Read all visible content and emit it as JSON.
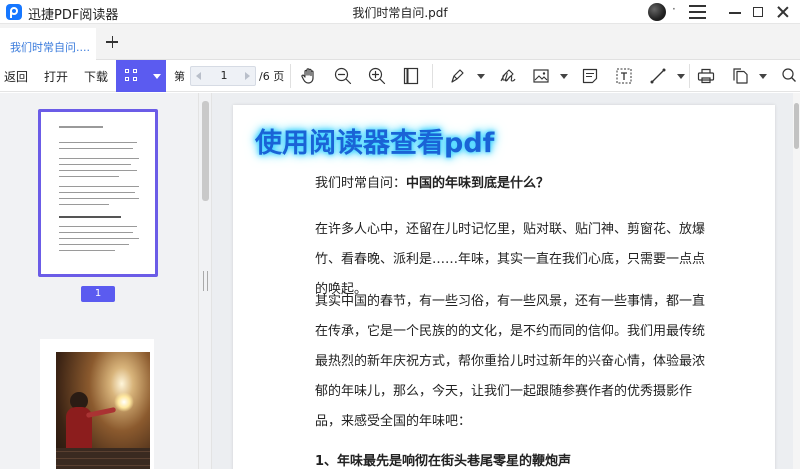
{
  "app": {
    "name": "迅捷PDF阅读器",
    "document_title": "我们时常自问.pdf"
  },
  "tabs": [
    {
      "label": "我们时常自问...."
    }
  ],
  "toolbar": {
    "back": "返回",
    "open": "打开",
    "download": "下载",
    "page_prefix": "第",
    "current_page": "1",
    "page_total": "/6 页"
  },
  "sidebar": {
    "page_badge": "1"
  },
  "document": {
    "banner": "使用阅读器查看pdf",
    "question_prefix": "我们时常自问：",
    "question_bold": "中国的年味到底是什么？",
    "p1": "在许多人心中，还留在儿时记忆里，贴对联、贴门神、剪窗花、放爆竹、看春晚、派利是……年味，其实一直在我们心底，只需要一点点的唤起。",
    "p2": "其实中国的春节，有一些习俗，有一些风景，还有一些事情，都一直在传承，它是一个民族的的文化，是不约而同的信仰。我们用最传统最热烈的新年庆祝方式，帮你重拾儿时过新年的兴奋心情，体验最浓郁的年味儿，那么，今天，让我们一起跟随参赛作者的优秀摄影作品，来感受全国的年味吧：",
    "heading1": "1、年味最先是响彻在街头巷尾零星的鞭炮声"
  },
  "colors": {
    "accent": "#5b5bf0",
    "tab_text": "#3a7bdc",
    "banner": "#1a63d6",
    "banner_glow": "#3ad2ff"
  },
  "icons": [
    "app-logo-icon",
    "menu-icon",
    "minimize-icon",
    "maximize-icon",
    "close-icon",
    "add-tab-icon",
    "grid-view-icon",
    "hand-tool-icon",
    "zoom-out-icon",
    "zoom-in-icon",
    "fit-page-icon",
    "highlighter-icon",
    "signature-icon",
    "image-icon",
    "note-icon",
    "text-box-icon",
    "line-tool-icon",
    "print-icon",
    "copy-pages-icon",
    "search-icon"
  ]
}
